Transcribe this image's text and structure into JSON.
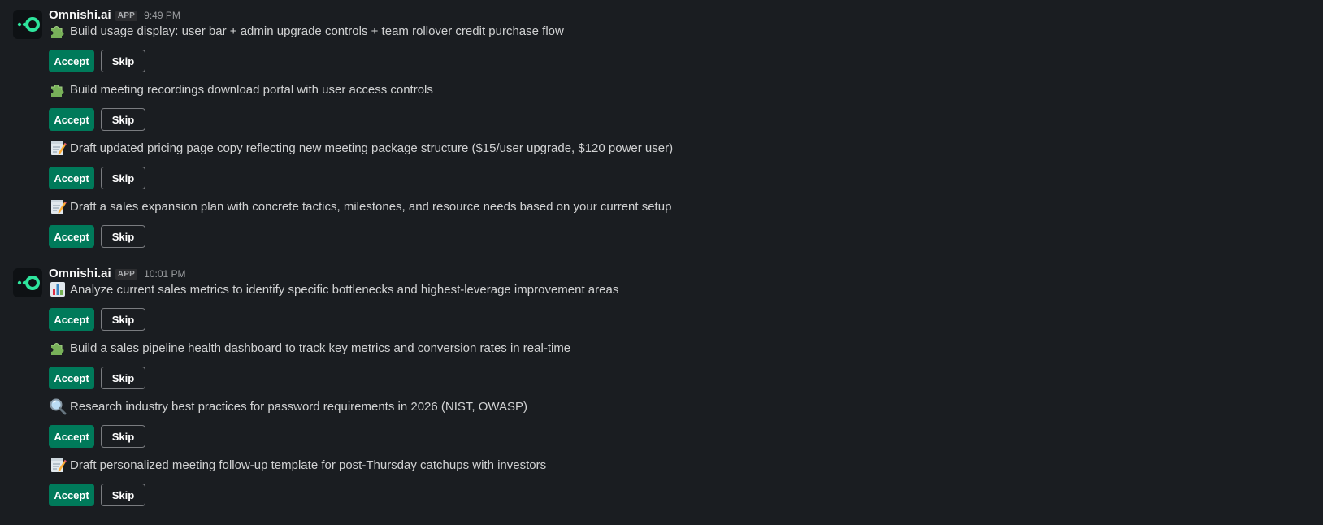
{
  "colors": {
    "background": "#1a1d21",
    "accept_button": "#007a5a",
    "logo_accent": "#2ee59d"
  },
  "messages": [
    {
      "sender": "Omnishi.ai",
      "badge": "APP",
      "time": "9:49 PM",
      "avatar_icon": "omnishi-logo-icon",
      "tasks": [
        {
          "icon": "puzzle-piece-icon",
          "text": "Build usage display: user bar + admin upgrade controls + team rollover credit purchase flow",
          "accept": "Accept",
          "skip": "Skip"
        },
        {
          "icon": "puzzle-piece-icon",
          "text": "Build meeting recordings download portal with user access controls",
          "accept": "Accept",
          "skip": "Skip"
        },
        {
          "icon": "memo-icon",
          "text": "Draft updated pricing page copy reflecting new meeting package structure ($15/user upgrade, $120 power user)",
          "accept": "Accept",
          "skip": "Skip"
        },
        {
          "icon": "memo-icon",
          "text": "Draft a sales expansion plan with concrete tactics, milestones, and resource needs based on your current setup",
          "accept": "Accept",
          "skip": "Skip"
        }
      ]
    },
    {
      "sender": "Omnishi.ai",
      "badge": "APP",
      "time": "10:01 PM",
      "avatar_icon": "omnishi-logo-icon",
      "tasks": [
        {
          "icon": "bar-chart-icon",
          "text": "Analyze current sales metrics to identify specific bottlenecks and highest-leverage improvement areas",
          "accept": "Accept",
          "skip": "Skip"
        },
        {
          "icon": "puzzle-piece-icon",
          "text": "Build a sales pipeline health dashboard to track key metrics and conversion rates in real-time",
          "accept": "Accept",
          "skip": "Skip"
        },
        {
          "icon": "magnifying-glass-icon",
          "text": "Research industry best practices for password requirements in 2026 (NIST, OWASP)",
          "accept": "Accept",
          "skip": "Skip"
        },
        {
          "icon": "memo-icon",
          "text": "Draft personalized meeting follow-up template for post-Thursday catchups with investors",
          "accept": "Accept",
          "skip": "Skip"
        }
      ]
    }
  ]
}
